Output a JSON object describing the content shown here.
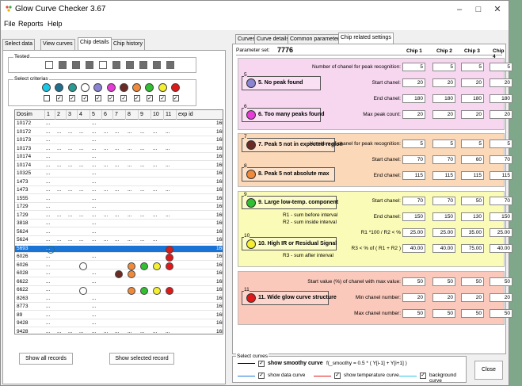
{
  "window": {
    "title": "Glow Curve Checker 3.67",
    "minimize": "–",
    "maximize": "□",
    "close": "✕"
  },
  "menu": [
    "File",
    "Reports",
    "Help"
  ],
  "left_tabs": [
    "Select data",
    "View curves",
    "Chip details",
    "Chip history"
  ],
  "left_active_tab": 2,
  "tested": {
    "label": "Tested",
    "squares": [
      false,
      true,
      true,
      true,
      false,
      true,
      true,
      true,
      true,
      true
    ]
  },
  "criteria": {
    "label": "Select criterias",
    "dots": [
      "#18c8e8",
      "#1f6f8f",
      "#2a9a95",
      "#ffffff",
      "#8a84d4",
      "#e83ad8",
      "#6b2a24",
      "#f08a3a",
      "#30c030",
      "#f4f030",
      "#e01818"
    ],
    "checks": [
      false,
      true,
      true,
      true,
      true,
      true,
      true,
      true,
      true,
      true,
      true
    ]
  },
  "grid": {
    "headers": [
      "Dosim",
      "1",
      "2",
      "3",
      "4",
      "5",
      "6",
      "7",
      "8",
      "9",
      "10",
      "11",
      "exp id"
    ],
    "rows": [
      {
        "dosim": "10172",
        "c1": "...",
        "dash": [
          false,
          false,
          false,
          true,
          false,
          false,
          false,
          false,
          false,
          false
        ],
        "exp": "16E"
      },
      {
        "dosim": "10172",
        "c1": "...",
        "dash": [
          true,
          true,
          true,
          true,
          true,
          true,
          true,
          true,
          true,
          true
        ],
        "exp": "16E"
      },
      {
        "dosim": "10173",
        "c1": "...",
        "dash": [
          false,
          false,
          false,
          true,
          false,
          false,
          false,
          false,
          false,
          false
        ],
        "exp": "16E"
      },
      {
        "dosim": "10173",
        "c1": "...",
        "dash": [
          true,
          true,
          true,
          true,
          true,
          true,
          true,
          true,
          true,
          true
        ],
        "exp": "16E"
      },
      {
        "dosim": "10174",
        "c1": "...",
        "dash": [
          false,
          false,
          false,
          true,
          false,
          false,
          false,
          false,
          false,
          false
        ],
        "exp": "16E"
      },
      {
        "dosim": "10174",
        "c1": "...",
        "dash": [
          true,
          true,
          true,
          true,
          true,
          true,
          true,
          true,
          true,
          true
        ],
        "exp": "16E"
      },
      {
        "dosim": "10325",
        "c1": "...",
        "dash": [
          false,
          false,
          false,
          true,
          false,
          false,
          false,
          false,
          false,
          false
        ],
        "exp": "16E"
      },
      {
        "dosim": "1473",
        "c1": "...",
        "dash": [
          false,
          false,
          false,
          true,
          false,
          false,
          false,
          false,
          false,
          false
        ],
        "exp": "16E"
      },
      {
        "dosim": "1473",
        "c1": "...",
        "dash": [
          true,
          true,
          true,
          true,
          true,
          true,
          true,
          true,
          true,
          true
        ],
        "exp": "16E"
      },
      {
        "dosim": "1555",
        "c1": "...",
        "dash": [
          false,
          false,
          false,
          true,
          false,
          false,
          false,
          false,
          false,
          false
        ],
        "exp": "16E"
      },
      {
        "dosim": "1729",
        "c1": "...",
        "dash": [
          false,
          false,
          false,
          true,
          false,
          false,
          false,
          false,
          false,
          false
        ],
        "exp": "16E"
      },
      {
        "dosim": "1729",
        "c1": "...",
        "dash": [
          true,
          true,
          true,
          true,
          true,
          true,
          true,
          true,
          true,
          true
        ],
        "exp": "16E"
      },
      {
        "dosim": "3818",
        "c1": "...",
        "dash": [
          false,
          false,
          false,
          true,
          false,
          false,
          false,
          false,
          false,
          false
        ],
        "exp": "16E"
      },
      {
        "dosim": "5624",
        "c1": "...",
        "dash": [
          false,
          false,
          false,
          true,
          false,
          false,
          false,
          false,
          false,
          false
        ],
        "exp": "16E"
      },
      {
        "dosim": "5624",
        "c1": "...",
        "dash": [
          true,
          true,
          true,
          true,
          true,
          true,
          true,
          true,
          true,
          false
        ],
        "exp": "16E"
      },
      {
        "dosim": "5693",
        "c1": "...",
        "dash": [
          false,
          false,
          false,
          false,
          false,
          false,
          false,
          false,
          false,
          false
        ],
        "exp": "16E",
        "selected": true
      },
      {
        "dosim": "6026",
        "c1": "...",
        "dash": [
          false,
          false,
          false,
          true,
          false,
          false,
          false,
          false,
          false,
          false
        ],
        "exp": "16E"
      },
      {
        "dosim": "6026",
        "c1": "...",
        "dash": [
          false,
          false,
          false,
          false,
          false,
          false,
          false,
          false,
          false,
          false
        ],
        "exp": "16E"
      },
      {
        "dosim": "6028",
        "c1": "...",
        "dash": [
          false,
          false,
          false,
          true,
          false,
          false,
          false,
          false,
          false,
          false
        ],
        "exp": "16E"
      },
      {
        "dosim": "6622",
        "c1": "...",
        "dash": [
          false,
          false,
          false,
          true,
          false,
          false,
          false,
          false,
          false,
          false
        ],
        "exp": "16E"
      },
      {
        "dosim": "6622",
        "c1": "...",
        "dash": [
          false,
          false,
          false,
          false,
          false,
          false,
          false,
          false,
          false,
          false
        ],
        "exp": "16E"
      },
      {
        "dosim": "8263",
        "c1": "...",
        "dash": [
          false,
          false,
          false,
          true,
          false,
          false,
          false,
          false,
          false,
          false
        ],
        "exp": "16E"
      },
      {
        "dosim": "8773",
        "c1": "...",
        "dash": [
          false,
          false,
          false,
          true,
          false,
          false,
          false,
          false,
          false,
          false
        ],
        "exp": "16E"
      },
      {
        "dosim": "89",
        "c1": "...",
        "dash": [
          false,
          false,
          false,
          true,
          false,
          false,
          false,
          false,
          false,
          false
        ],
        "exp": "16E"
      },
      {
        "dosim": "9428",
        "c1": "...",
        "dash": [
          false,
          false,
          false,
          true,
          false,
          false,
          false,
          false,
          false,
          false
        ],
        "exp": "16E"
      },
      {
        "dosim": "9428",
        "c1": "...",
        "dash": [
          true,
          true,
          true,
          true,
          true,
          true,
          true,
          true,
          true,
          true
        ],
        "exp": "16E"
      }
    ]
  },
  "left_buttons": {
    "all": "Show all records",
    "selected": "Show selected record"
  },
  "right_tabs": [
    "Curves",
    "Curve details",
    "Common parameters",
    "Chip related settings"
  ],
  "right_active_tab": 3,
  "param_set": {
    "label": "Parameter set:",
    "value": "7776"
  },
  "chips": [
    "Chip 1",
    "Chip 2",
    "Chip 3",
    "Chip 4"
  ],
  "sections": {
    "s1": {
      "rows": [
        {
          "label": "Number of chanel for peak recognition:",
          "vals": [
            "5",
            "5",
            "5",
            "5"
          ]
        },
        {
          "label": "Start chanel:",
          "vals": [
            "20",
            "20",
            "20",
            "20"
          ]
        },
        {
          "label": "End chanel:",
          "vals": [
            "180",
            "180",
            "180",
            "180"
          ]
        },
        {
          "label": "Max peak count:",
          "vals": [
            "20",
            "20",
            "20",
            "20"
          ]
        }
      ],
      "c5": {
        "num": "5",
        "text": "5. No peak found"
      },
      "c6": {
        "num": "6",
        "text": "6. Too many peaks found"
      }
    },
    "s2": {
      "rows": [
        {
          "label": "Numbers of chanel for peak recognition:",
          "vals": [
            "5",
            "5",
            "5",
            "5"
          ]
        },
        {
          "label": "Start chanel:",
          "vals": [
            "70",
            "70",
            "60",
            "70"
          ]
        },
        {
          "label": "End chanel:",
          "vals": [
            "115",
            "115",
            "115",
            "115"
          ]
        }
      ],
      "c7": {
        "num": "7",
        "text": "7. Peak 5 not in expected region"
      },
      "c8": {
        "num": "8",
        "text": "8. Peak 5 not absolute max"
      }
    },
    "s3": {
      "rows": [
        {
          "label": "Start chanel:",
          "vals": [
            "70",
            "70",
            "50",
            "70"
          ]
        },
        {
          "label": "End chanel:",
          "vals": [
            "150",
            "150",
            "130",
            "150"
          ]
        },
        {
          "label": "R1 *100 / R2 < %",
          "vals": [
            "25.00",
            "25.00",
            "35.00",
            "25.00"
          ]
        },
        {
          "label": "R3 < % of ( R1 + R2 )",
          "vals": [
            "40.00",
            "40.00",
            "75.00",
            "40.00"
          ]
        }
      ],
      "c9": {
        "num": "9",
        "text": "9. Large low-temp. component",
        "sub1": "R1 - sum before interval",
        "sub2": "R2 - sum inside interval"
      },
      "c10": {
        "num": "10",
        "text": "10. High IR or Residual Signal",
        "sub1": "R3 - sum after interval"
      }
    },
    "s4": {
      "rows": [
        {
          "label": "Start value (%) of chanel with max value:",
          "vals": [
            "50",
            "50",
            "50",
            "50"
          ]
        },
        {
          "label": "Min chanel number:",
          "vals": [
            "20",
            "20",
            "20",
            "20"
          ]
        },
        {
          "label": "Max chanel number:",
          "vals": [
            "50",
            "50",
            "50",
            "50"
          ]
        }
      ],
      "c11": {
        "num": "11",
        "text": "11. Wide glow curve structure"
      }
    }
  },
  "select_curves": {
    "label": "Select curves",
    "smoothy": "show smoothy curve",
    "formula": "f(_smoothy = 0.5 * ( Y[i-1] + Y[i+1] )",
    "data": "show data curve",
    "temperature": "show temperature curve",
    "background": "background curve"
  },
  "close_label": "Close",
  "check_mark": "✓"
}
